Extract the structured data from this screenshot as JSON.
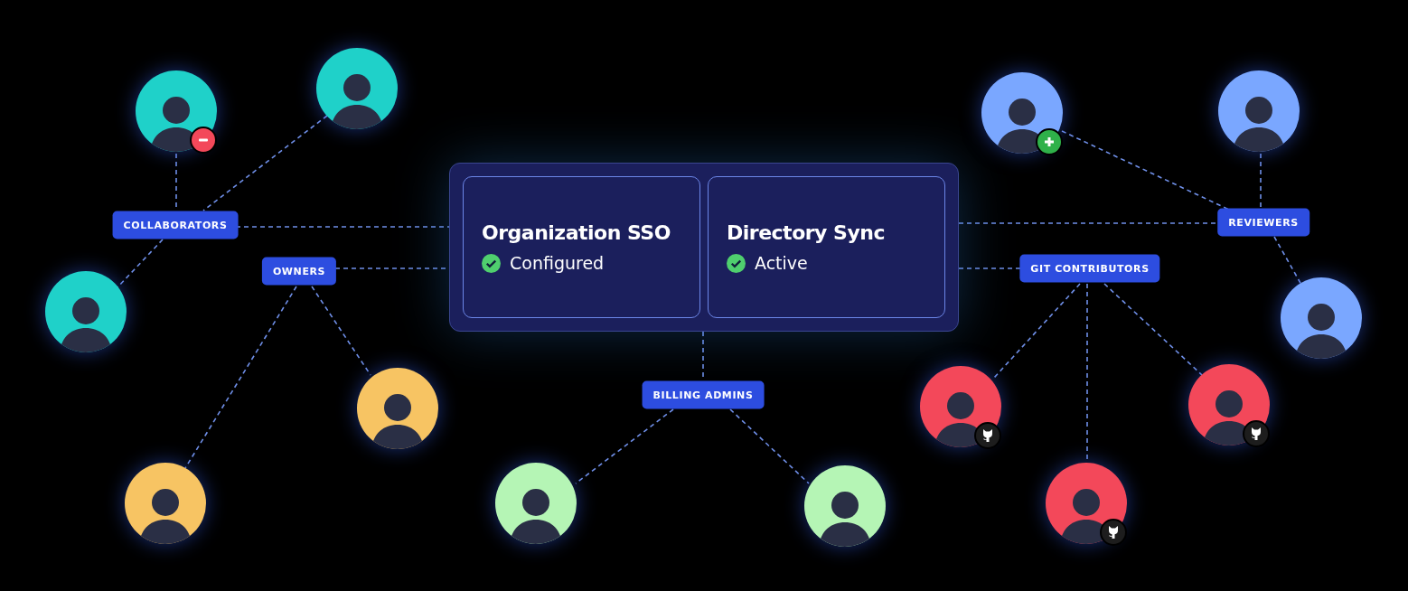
{
  "panels": [
    {
      "title": "Organization SSO",
      "status": "Configured"
    },
    {
      "title": "Directory Sync",
      "status": "Active"
    }
  ],
  "roles": [
    {
      "label": "COLLABORATORS"
    },
    {
      "label": "OWNERS"
    },
    {
      "label": "BILLING ADMINS"
    },
    {
      "label": "REVIEWERS"
    },
    {
      "label": "GIT CONTRIBUTORS"
    }
  ],
  "people": [
    {
      "color": "#1fd1c9",
      "kind": "remove"
    },
    {
      "color": "#1fd1c9",
      "kind": "plain"
    },
    {
      "color": "#1fd1c9",
      "kind": "plain"
    },
    {
      "color": "#f7c463",
      "kind": "plain"
    },
    {
      "color": "#f7c463",
      "kind": "plain"
    },
    {
      "color": "#b5f5b5",
      "kind": "plain"
    },
    {
      "color": "#b5f5b5",
      "kind": "plain"
    },
    {
      "color": "#7aa7ff",
      "kind": "add"
    },
    {
      "color": "#7aa7ff",
      "kind": "plain"
    },
    {
      "color": "#7aa7ff",
      "kind": "plain"
    },
    {
      "color": "#f3485a",
      "kind": "github"
    },
    {
      "color": "#f3485a",
      "kind": "github"
    },
    {
      "color": "#f3485a",
      "kind": "github"
    }
  ]
}
